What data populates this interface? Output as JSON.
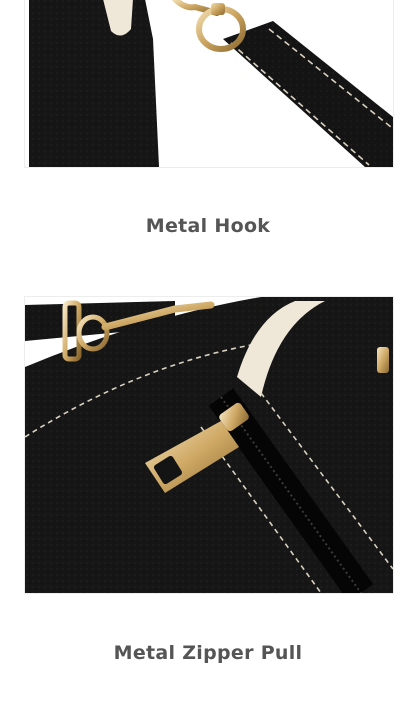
{
  "sections": [
    {
      "caption": "Metal Hook",
      "subject": "strap-hook"
    },
    {
      "caption": "Metal Zipper Pull",
      "subject": "zipper-pull"
    }
  ],
  "colors": {
    "leather": "#161616",
    "stitching": "#d9d2c2",
    "metal_gold": "#c9a25e",
    "cream_trim": "#efe7d8",
    "caption": "#555555"
  }
}
